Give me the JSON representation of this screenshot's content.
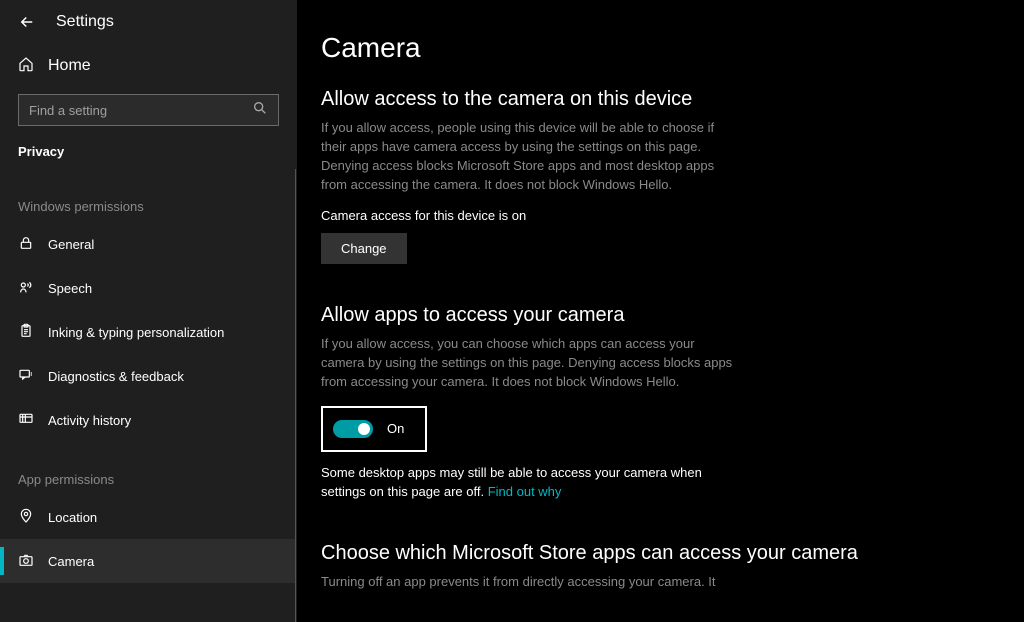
{
  "header": {
    "title": "Settings",
    "home": "Home"
  },
  "search": {
    "placeholder": "Find a setting"
  },
  "category": "Privacy",
  "groups": {
    "windows": {
      "label": "Windows permissions",
      "items": [
        {
          "label": "General"
        },
        {
          "label": "Speech"
        },
        {
          "label": "Inking & typing personalization"
        },
        {
          "label": "Diagnostics & feedback"
        },
        {
          "label": "Activity history"
        }
      ]
    },
    "app": {
      "label": "App permissions",
      "items": [
        {
          "label": "Location"
        },
        {
          "label": "Camera"
        }
      ]
    }
  },
  "main": {
    "title": "Camera",
    "s1": {
      "heading": "Allow access to the camera on this device",
      "desc": "If you allow access, people using this device will be able to choose if their apps have camera access by using the settings on this page. Denying access blocks Microsoft Store apps and most desktop apps from accessing the camera. It does not block Windows Hello.",
      "status": "Camera access for this device is on",
      "button": "Change"
    },
    "s2": {
      "heading": "Allow apps to access your camera",
      "desc": "If you allow access, you can choose which apps can access your camera by using the settings on this page. Denying access blocks apps from accessing your camera. It does not block Windows Hello.",
      "toggle_label": "On",
      "note_prefix": "Some desktop apps may still be able to access your camera when settings on this page are off. ",
      "note_link": "Find out why"
    },
    "s3": {
      "heading": "Choose which Microsoft Store apps can access your camera",
      "desc": "Turning off an app prevents it from directly accessing your camera. It"
    }
  }
}
